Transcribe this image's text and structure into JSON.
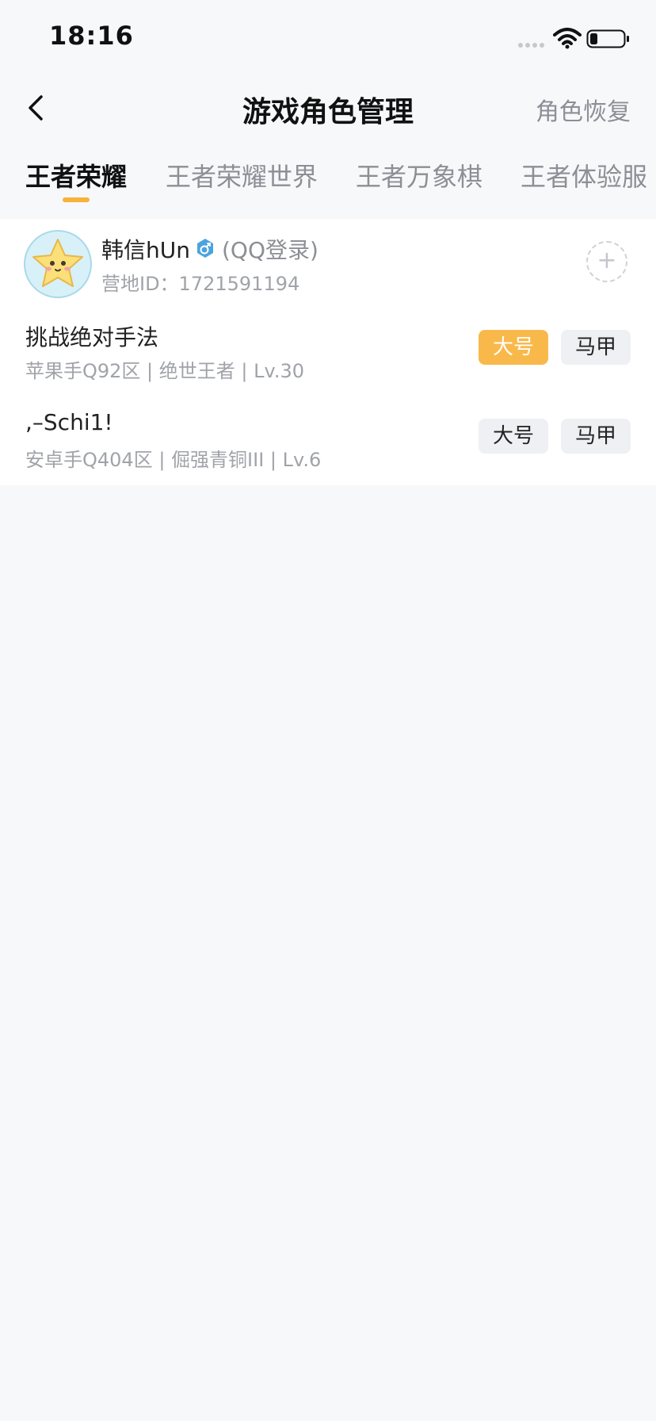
{
  "status_bar": {
    "time": "18:16"
  },
  "nav": {
    "title": "游戏角色管理",
    "restore_label": "角色恢复"
  },
  "tabs": [
    {
      "label": "王者荣耀",
      "active": true
    },
    {
      "label": "王者荣耀世界",
      "active": false
    },
    {
      "label": "王者万象棋",
      "active": false
    },
    {
      "label": "王者体验服",
      "active": false
    }
  ],
  "account": {
    "username": "韩信hUn",
    "login_type": "(QQ登录)",
    "camp_id": "营地ID：1721591194",
    "add_symbol": "+"
  },
  "roles": [
    {
      "name": "挑战绝对手法",
      "detail": "苹果手Q92区 | 绝世王者 | Lv.30",
      "main_label": "大号",
      "alt_label": "马甲",
      "selected": "main"
    },
    {
      "name": ",–Schi1!",
      "detail": "安卓手Q404区 | 倔强青铜III | Lv.6",
      "main_label": "大号",
      "alt_label": "马甲",
      "selected": "none"
    }
  ],
  "colors": {
    "accent": "#f9b94a",
    "indicator": "#f7b23b",
    "verified": "#4aa3df"
  },
  "icons": {
    "back": "chevron-left-icon",
    "verified": "verified-badge-icon",
    "wifi": "wifi-icon",
    "battery": "battery-icon"
  }
}
